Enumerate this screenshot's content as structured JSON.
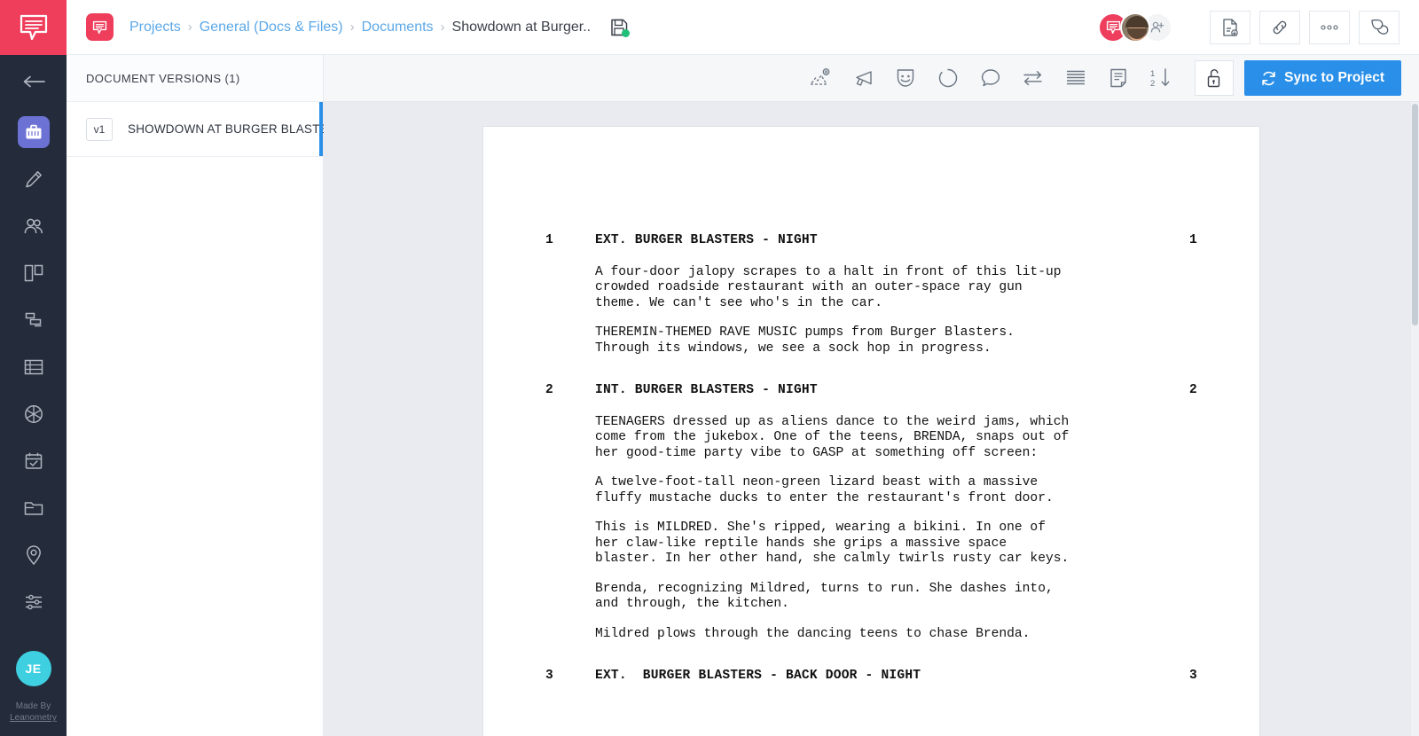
{
  "brand": {
    "accent_pink": "#ef3e5c",
    "accent_blue": "#2a8fe8",
    "rail_bg": "#242b3a",
    "active_nav": "#6c72d4",
    "avatar_teal": "#3ed0e0",
    "save_green": "#21c07a"
  },
  "rail": {
    "logo_icon": "speech-bubble-logo-icon",
    "back_icon": "arrow-left-icon",
    "items": [
      {
        "icon": "briefcase-icon",
        "name": "projects",
        "active": true
      },
      {
        "icon": "pencil-icon",
        "name": "write",
        "active": false
      },
      {
        "icon": "people-icon",
        "name": "cast-crew",
        "active": false
      },
      {
        "icon": "columns-board-icon",
        "name": "storyboard",
        "active": false
      },
      {
        "icon": "gantt-icon",
        "name": "schedule",
        "active": false
      },
      {
        "icon": "table-rows-icon",
        "name": "breakdown",
        "active": false
      },
      {
        "icon": "aperture-icon",
        "name": "shot-list",
        "active": false
      },
      {
        "icon": "calendar-check-icon",
        "name": "calendar",
        "active": false
      },
      {
        "icon": "folder-icon",
        "name": "files",
        "active": false
      },
      {
        "icon": "map-pin-icon",
        "name": "locations",
        "active": false
      },
      {
        "icon": "sliders-icon",
        "name": "settings",
        "active": false
      }
    ],
    "user_initials": "JE",
    "footer_line1": "Made By",
    "footer_line2": "Leanometry"
  },
  "topbar": {
    "doc_badge_icon": "document-app-icon",
    "breadcrumbs": [
      {
        "label": "Projects",
        "current": false
      },
      {
        "label": "General (Docs & Files)",
        "current": false
      },
      {
        "label": "Documents",
        "current": false
      },
      {
        "label": "Showdown at Burger..",
        "current": true
      }
    ],
    "separator": "›",
    "save_icon": "floppy-disk-save-icon",
    "avatars": [
      {
        "name": "app-avatar",
        "initials": ""
      },
      {
        "name": "user-avatar-photo",
        "initials": ""
      },
      {
        "name": "add-collaborator-avatar",
        "initials": ""
      }
    ],
    "actions": [
      {
        "icon": "export-pdf-icon",
        "name": "export-pdf-button"
      },
      {
        "icon": "link-icon",
        "name": "share-link-button"
      },
      {
        "icon": "more-dots-icon",
        "name": "more-options-button"
      },
      {
        "icon": "comments-icon",
        "name": "comments-button"
      }
    ]
  },
  "versions_panel": {
    "title": "DOCUMENT VERSIONS (1)",
    "rows": [
      {
        "tag": "v1",
        "name": "SHOWDOWN AT BURGER BLASTE...",
        "selected": true
      }
    ]
  },
  "toolbar": {
    "icons": [
      {
        "icon": "image-settings-icon",
        "name": "media-tool"
      },
      {
        "icon": "megaphone-icon",
        "name": "announce-tool"
      },
      {
        "icon": "theater-mask-icon",
        "name": "characters-tool"
      },
      {
        "icon": "circle-outline-icon",
        "name": "status-tool"
      },
      {
        "icon": "comment-bubble-icon",
        "name": "comment-tool"
      },
      {
        "icon": "swap-arrows-icon",
        "name": "revisions-tool"
      },
      {
        "icon": "lines-list-icon",
        "name": "outline-tool"
      },
      {
        "icon": "page-note-icon",
        "name": "notes-tool"
      },
      {
        "icon": "sort-numeric-icon",
        "name": "scene-numbering-tool"
      }
    ],
    "lock_icon": "unlocked-padlock-icon",
    "sync_icon": "refresh-icon",
    "sync_label": "Sync to Project"
  },
  "script": {
    "scenes": [
      {
        "number": "1",
        "slug": "EXT. BURGER BLASTERS - NIGHT",
        "action": [
          "A four-door jalopy scrapes to a halt in front of this lit-up\ncrowded roadside restaurant with an outer-space ray gun\ntheme. We can't see who's in the car.",
          "THEREMIN-THEMED RAVE MUSIC pumps from Burger Blasters.\nThrough its windows, we see a sock hop in progress."
        ]
      },
      {
        "number": "2",
        "slug": "INT. BURGER BLASTERS - NIGHT",
        "action": [
          "TEENAGERS dressed up as aliens dance to the weird jams, which\ncome from the jukebox. One of the teens, BRENDA, snaps out of\nher good-time party vibe to GASP at something off screen:",
          "A twelve-foot-tall neon-green lizard beast with a massive\nfluffy mustache ducks to enter the restaurant's front door.",
          "This is MILDRED. She's ripped, wearing a bikini. In one of\nher claw-like reptile hands she grips a massive space\nblaster. In her other hand, she calmly twirls rusty car keys.",
          "Brenda, recognizing Mildred, turns to run. She dashes into,\nand through, the kitchen.",
          "Mildred plows through the dancing teens to chase Brenda."
        ]
      },
      {
        "number": "3",
        "slug": "EXT.  BURGER BLASTERS - BACK DOOR - NIGHT",
        "action": []
      }
    ]
  }
}
